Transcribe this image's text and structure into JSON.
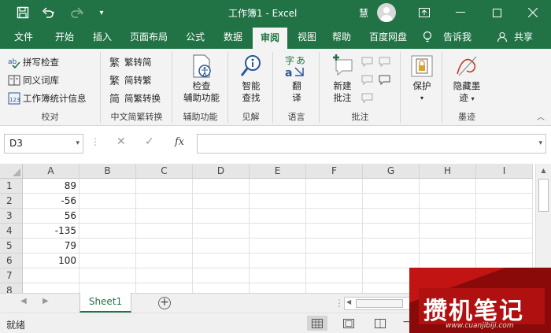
{
  "titlebar": {
    "title": "工作簿1  -  Excel",
    "user": "慧",
    "icons": [
      "save-icon",
      "undo-icon",
      "redo-icon",
      "customize-icon",
      "ribbon-display-icon",
      "minimize-icon",
      "maximize-icon",
      "close-icon"
    ]
  },
  "tabs": [
    {
      "label": "文件"
    },
    {
      "label": "开始"
    },
    {
      "label": "插入"
    },
    {
      "label": "页面布局"
    },
    {
      "label": "公式"
    },
    {
      "label": "数据"
    },
    {
      "label": "审阅",
      "active": true
    },
    {
      "label": "视图"
    },
    {
      "label": "帮助"
    },
    {
      "label": "百度网盘"
    },
    {
      "label": "告诉我"
    },
    {
      "label": "共享"
    }
  ],
  "ribbon": {
    "proofing": {
      "label": "校对",
      "spelling": "拼写检查",
      "thesaurus": "同义词库",
      "stats": "工作簿统计信息"
    },
    "chinese": {
      "label": "中文简繁转换",
      "to_simplified": "繁转简",
      "to_traditional": "简转繁",
      "convert": "简繁转换"
    },
    "accessibility": {
      "label": "辅助功能",
      "check_line1": "检查",
      "check_line2": "辅助功能"
    },
    "insights": {
      "label": "见解",
      "smart_line1": "智能",
      "smart_line2": "查找"
    },
    "language": {
      "label": "语言",
      "translate_line1": "翻",
      "translate_line2": "译"
    },
    "comments": {
      "label": "批注",
      "new_line1": "新建",
      "new_line2": "批注"
    },
    "protect": {
      "label": "保护"
    },
    "ink": {
      "label": "墨迹",
      "hide_line1": "隐藏墨",
      "hide_line2": "迹"
    }
  },
  "formula_bar": {
    "name_box": "D3",
    "fx": "fx",
    "dots": "⋮",
    "formula": ""
  },
  "grid": {
    "columns": [
      "A",
      "B",
      "C",
      "D",
      "E",
      "F",
      "G",
      "H",
      "I"
    ],
    "rows": [
      "1",
      "2",
      "3",
      "4",
      "5",
      "6",
      "7",
      "8"
    ],
    "values_a": [
      "89",
      "-56",
      "56",
      "-135",
      "79",
      "100",
      "",
      ""
    ]
  },
  "sheets": [
    {
      "name": "Sheet1",
      "active": true
    }
  ],
  "status": {
    "text": "就绪",
    "zoom_minus": "−"
  },
  "watermark": {
    "text": "攒机笔记",
    "url": "www.cuanjibiji.com"
  },
  "colors": {
    "accent": "#217346",
    "watermark": "#b01010"
  }
}
